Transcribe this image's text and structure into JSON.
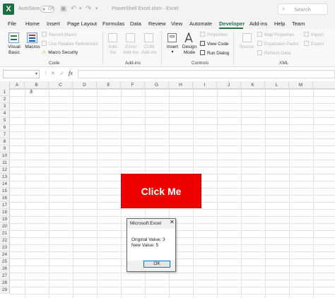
{
  "titlebar": {
    "autosave_label": "AutoSave",
    "autosave_state": "Off",
    "filename": "PowerShell Excel.xlsm  -  Excel",
    "search_placeholder": "Search"
  },
  "menu": {
    "tabs": [
      "File",
      "Home",
      "Insert",
      "Page Layout",
      "Formulas",
      "Data",
      "Review",
      "View",
      "Automate",
      "Developer",
      "Add-ins",
      "Help",
      "Team"
    ],
    "active": "Developer",
    "accent_color": "#217346"
  },
  "ribbon": {
    "code": {
      "visual_basic": "Visual\nBasic",
      "macros": "Macros",
      "record_macro": "Record Macro",
      "use_relative": "Use Relative References",
      "macro_security": "Macro Security",
      "group": "Code"
    },
    "addins": {
      "addins": "Add-\nins",
      "excel_addins": "Excel\nAdd-ins",
      "com_addins": "COM\nAdd-ins",
      "group": "Add-ins"
    },
    "controls": {
      "insert": "Insert",
      "design_mode": "Design\nMode",
      "properties": "Properties",
      "view_code": "View Code",
      "run_dialog": "Run Dialog",
      "group": "Controls"
    },
    "xml": {
      "source": "Source",
      "map_properties": "Map Properties",
      "expansion_packs": "Expansion Packs",
      "refresh_data": "Refresh Data",
      "import": "Import",
      "export": "Export",
      "group": "XML"
    }
  },
  "formula_bar": {
    "fx": "fx",
    "cancel": "✕",
    "enter": "✓",
    "value": ""
  },
  "sheet": {
    "columns": [
      "A",
      "B",
      "C",
      "D",
      "E",
      "F",
      "G",
      "H",
      "I",
      "J",
      "K",
      "L",
      "M"
    ],
    "rows": [
      "1",
      "2",
      "3",
      "4",
      "5",
      "6",
      "7",
      "8",
      "9",
      "10",
      "11",
      "12",
      "13",
      "14",
      "15",
      "16",
      "17",
      "18",
      "19",
      "20",
      "21",
      "22",
      "23",
      "24",
      "25",
      "26",
      "27",
      "28",
      "29"
    ],
    "a1_value": "3",
    "button_label": "Click Me",
    "button_color": "#ee0000"
  },
  "dialog": {
    "title": "Microsoft Excel",
    "close": "✕",
    "line1": "Original Value:  3",
    "line2": "New Value:  5",
    "ok": "OK"
  }
}
